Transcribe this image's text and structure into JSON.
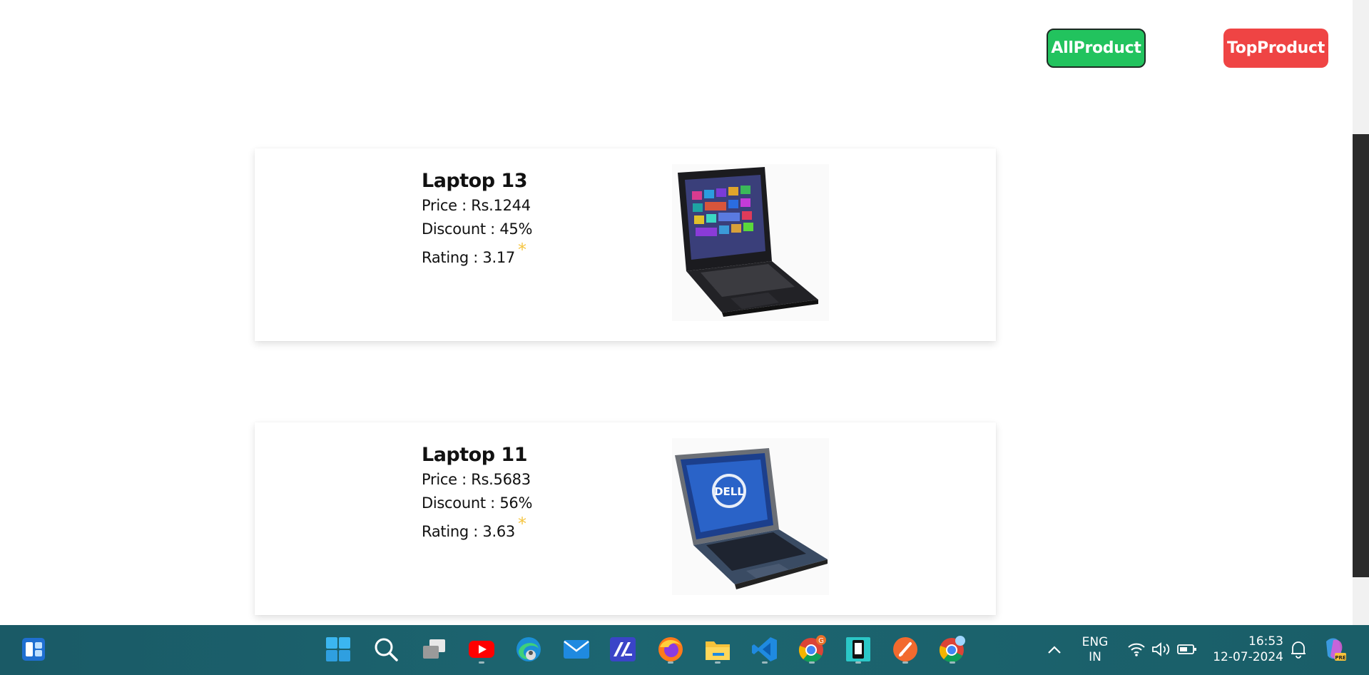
{
  "header": {
    "all_product_label": "AllProduct",
    "top_product_label": "TopProduct",
    "all_product_color": "#22c35e",
    "top_product_color": "#ef4444"
  },
  "products": [
    {
      "name": "Laptop 13",
      "price": "Price : Rs.1244",
      "discount": "Discount : 45%",
      "rating": "Rating : 3.17",
      "star": "*",
      "image_icon": "acer-laptop"
    },
    {
      "name": "Laptop 11",
      "price": "Price : Rs.5683",
      "discount": "Discount : 56%",
      "rating": "Rating : 3.63",
      "star": "*",
      "image_icon": "dell-laptop"
    }
  ],
  "taskbar": {
    "icons": [
      "widgets-icon",
      "start-icon",
      "search-icon",
      "task-view-icon",
      "youtube-icon",
      "edge-icon",
      "mail-icon",
      "editor-icon",
      "firefox-icon",
      "file-explorer-icon",
      "vscode-icon",
      "chrome-icon",
      "app-icon",
      "pen-icon",
      "chrome-beta-icon"
    ],
    "chrome_badge": "G",
    "language_top": "ENG",
    "language_bottom": "IN",
    "time": "16:53",
    "date": "12-07-2024"
  }
}
